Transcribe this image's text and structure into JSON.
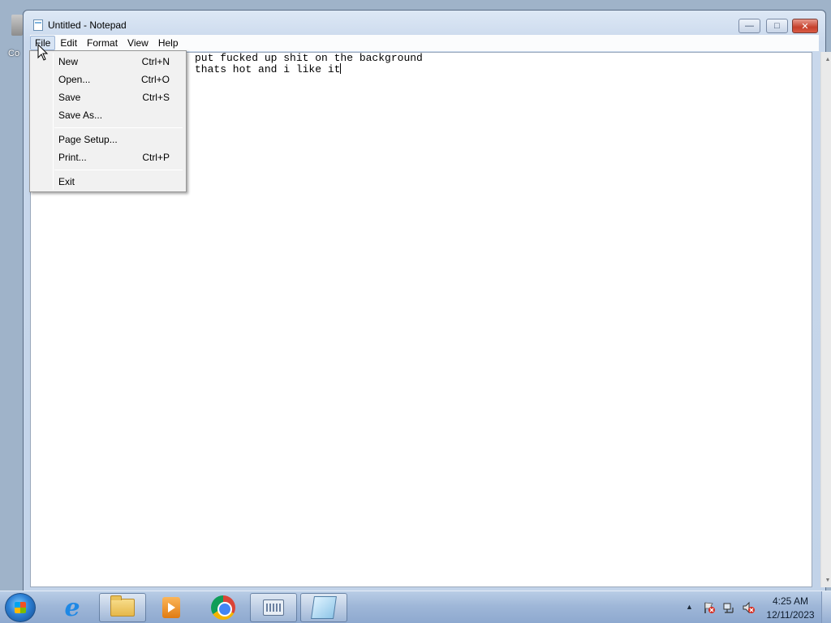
{
  "desktop": {
    "peek_label": "Co"
  },
  "window": {
    "title": "Untitled - Notepad",
    "controls": {
      "minimize": "—",
      "maximize": "□",
      "close": "✕"
    }
  },
  "menubar": {
    "items": [
      {
        "label": "File",
        "active": true
      },
      {
        "label": "Edit"
      },
      {
        "label": "Format"
      },
      {
        "label": "View"
      },
      {
        "label": "Help"
      }
    ]
  },
  "editor": {
    "lines": [
      "put fucked up shit on the background",
      "thats hot and i like it"
    ]
  },
  "file_menu": {
    "items": [
      {
        "label": "New",
        "shortcut": "Ctrl+N"
      },
      {
        "label": "Open...",
        "shortcut": "Ctrl+O"
      },
      {
        "label": "Save",
        "shortcut": "Ctrl+S"
      },
      {
        "label": "Save As...",
        "shortcut": ""
      },
      {
        "label": "Page Setup...",
        "shortcut": ""
      },
      {
        "label": "Print...",
        "shortcut": "Ctrl+P"
      },
      {
        "label": "Exit",
        "shortcut": ""
      }
    ]
  },
  "taskbar": {
    "apps": [
      {
        "icon": "internet-explorer-icon"
      },
      {
        "icon": "windows-explorer-icon"
      },
      {
        "icon": "media-player-icon"
      },
      {
        "icon": "chrome-icon"
      },
      {
        "icon": "on-screen-keyboard-icon"
      },
      {
        "icon": "notepad-icon"
      }
    ],
    "clock": {
      "time": "4:25 AM",
      "date": "12/11/2023"
    }
  },
  "colors": {
    "taskbar": "#9fb7d8",
    "window_frame": "#c9d8ec",
    "close_button": "#c6402c"
  }
}
